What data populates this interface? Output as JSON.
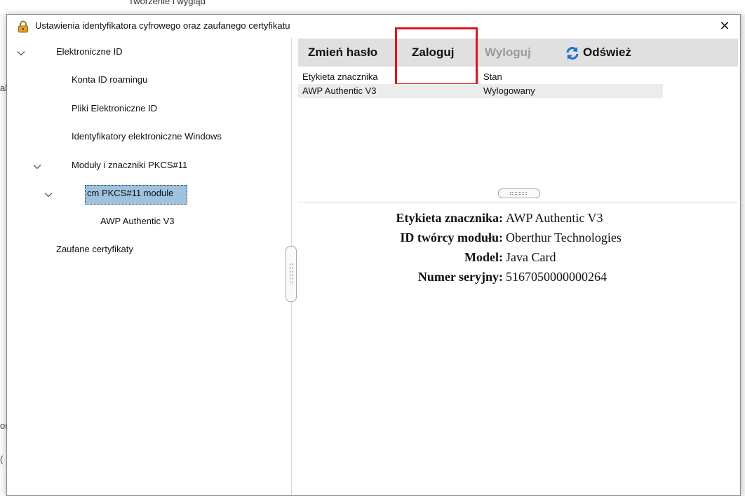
{
  "background": {
    "tab_text": "Tworzenie i wygląd",
    "left_fragments": [
      "al",
      "or",
      "("
    ]
  },
  "dialog": {
    "title": "Ustawienia identyfikatora cyfrowego oraz zaufanego certyfikatu",
    "close_label": "✕"
  },
  "tree": {
    "items": [
      {
        "label": "Elektroniczne ID",
        "expanded": true
      },
      {
        "label": "Konta ID roamingu"
      },
      {
        "label": "Pliki Elektroniczne ID"
      },
      {
        "label": "Identyfikatory elektroniczne Windows"
      },
      {
        "label": "Moduły i znaczniki PKCS#11",
        "expanded": true
      },
      {
        "label": "cm PKCS#11 module",
        "expanded": true,
        "selected": true
      },
      {
        "label": "AWP Authentic V3"
      },
      {
        "label": "Zaufane certyfikaty"
      }
    ]
  },
  "toolbar": {
    "change_password": "Zmień hasło",
    "login": "Zaloguj",
    "logout": "Wyloguj",
    "refresh": "Odśwież"
  },
  "table": {
    "columns": [
      "Etykieta znacznika",
      "Stan"
    ],
    "rows": [
      [
        "AWP Authentic V3",
        "Wylogowany"
      ]
    ]
  },
  "details": [
    {
      "label": "Etykieta znacznika:",
      "value": "AWP Authentic V3"
    },
    {
      "label": "ID twórcy modułu:",
      "value": "Oberthur Technologies"
    },
    {
      "label": "Model:",
      "value": "Java Card"
    },
    {
      "label": "Numer seryjny:",
      "value": "5167050000000264"
    }
  ],
  "colors": {
    "selection": "#9fc3df",
    "highlight_box": "#e0131b",
    "toolbar_bg": "#e0e0e0"
  }
}
